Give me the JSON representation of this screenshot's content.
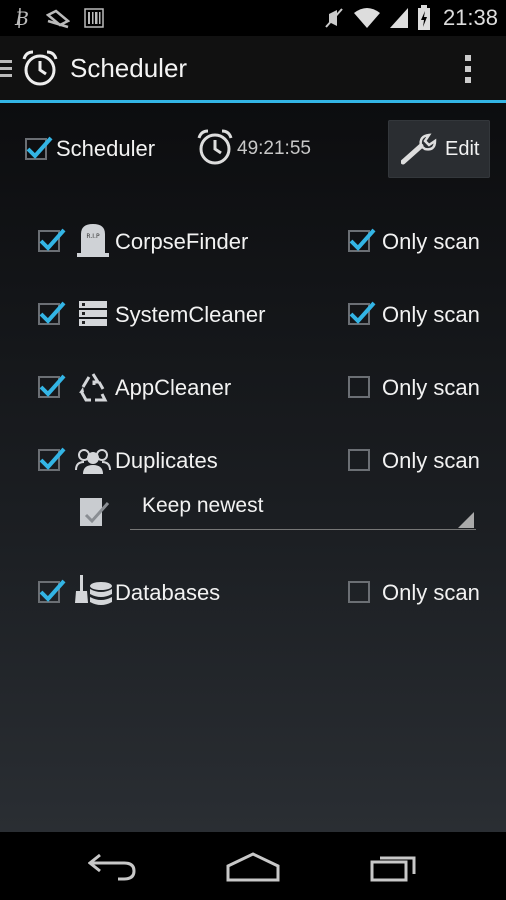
{
  "status_bar": {
    "time": "21:38",
    "left_icons": [
      "bitcoin-icon",
      "signal-stripes-icon",
      "barcode-icon"
    ],
    "right_icons": [
      "mute-icon",
      "wifi-icon",
      "signal-icon",
      "battery-icon"
    ]
  },
  "action_bar": {
    "title": "Scheduler",
    "icons": [
      "drawer-icon",
      "alarm-clock-icon",
      "overflow-menu-icon"
    ]
  },
  "header": {
    "scheduler_checkbox": true,
    "scheduler_label": "Scheduler",
    "timer_value": "49:21:55",
    "edit_label": "Edit"
  },
  "tools": [
    {
      "name": "CorpseFinder",
      "enabled": true,
      "only_scan_label": "Only scan",
      "only_scan": true,
      "icon": "tombstone-icon",
      "tombstone_text": "R.I.P"
    },
    {
      "name": "SystemCleaner",
      "enabled": true,
      "only_scan_label": "Only scan",
      "only_scan": true,
      "icon": "server-stack-icon"
    },
    {
      "name": "AppCleaner",
      "enabled": true,
      "only_scan_label": "Only scan",
      "only_scan": false,
      "icon": "recycle-icon"
    },
    {
      "name": "Duplicates",
      "enabled": true,
      "only_scan_label": "Only scan",
      "only_scan": false,
      "icon": "group-icon"
    },
    {
      "name": "Databases",
      "enabled": true,
      "only_scan_label": "Only scan",
      "only_scan": false,
      "icon": "database-broom-icon"
    }
  ],
  "duplicates_option": {
    "selected": "Keep newest"
  },
  "nav_bar": {
    "icons": [
      "back-icon",
      "home-icon",
      "recents-icon"
    ]
  },
  "colors": {
    "accent": "#33b5e5",
    "text": "#f2f2f2",
    "checkbox_border": "#6b6f74"
  }
}
